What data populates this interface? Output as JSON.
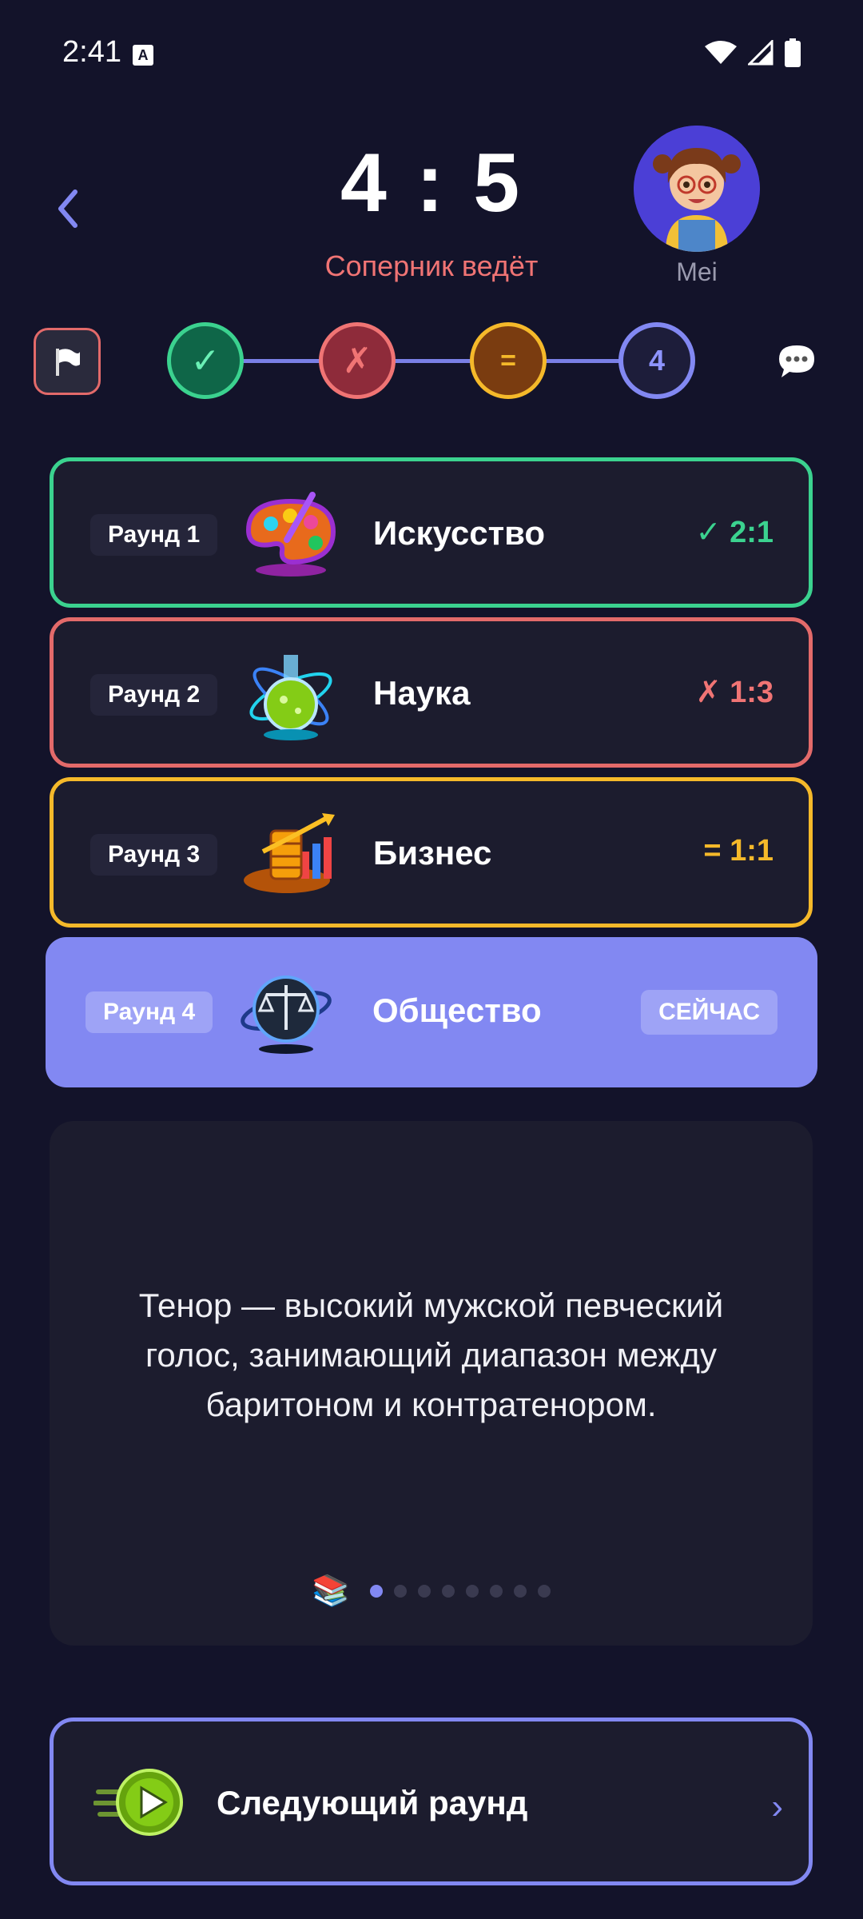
{
  "status_bar": {
    "time": "2:41",
    "notification_badge": "A"
  },
  "header": {
    "score": "4 : 5",
    "status": "Соперник ведёт",
    "opponent_name": "Mei"
  },
  "progress": {
    "steps": [
      {
        "symbol": "✓",
        "state": "win"
      },
      {
        "symbol": "✗",
        "state": "lose"
      },
      {
        "symbol": "=",
        "state": "draw"
      },
      {
        "symbol": "4",
        "state": "current"
      }
    ]
  },
  "rounds": [
    {
      "label": "Раунд 1",
      "category": "Искусство",
      "result": "✓ 2:1",
      "state": "win",
      "icon": "palette-icon"
    },
    {
      "label": "Раунд 2",
      "category": "Наука",
      "result": "✗ 1:3",
      "state": "lose",
      "icon": "flask-icon"
    },
    {
      "label": "Раунд 3",
      "category": "Бизнес",
      "result": "= 1:1",
      "state": "draw",
      "icon": "coins-chart-icon"
    },
    {
      "label": "Раунд 4",
      "category": "Общество",
      "badge": "СЕЙЧАС",
      "state": "current",
      "icon": "scales-icon"
    }
  ],
  "fact": {
    "text": "Тенор — высокий мужской певческий голос, занимающий диапазон между баритоном и контратенором.",
    "icon": "books-icon",
    "page_count": 8,
    "active_page": 1
  },
  "next_button": {
    "label": "Следующий раунд"
  },
  "colors": {
    "background": "#13132a",
    "card": "#1c1c2e",
    "accent": "#8288f2",
    "win": "#3bd28f",
    "lose": "#f07474",
    "draw": "#f5b92a"
  }
}
